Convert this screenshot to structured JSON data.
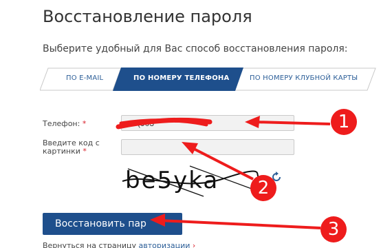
{
  "page": {
    "title": "Восстановление пароля",
    "subtitle": "Выберите удобный для Вас способ восстановления пароля:"
  },
  "tabs": [
    {
      "label": "ПО E-MAIL",
      "active": false
    },
    {
      "label": "ПО НОМЕРУ ТЕЛЕФОНА",
      "active": true
    },
    {
      "label": "ПО НОМЕРУ КЛУБНОЙ КАРТЫ",
      "active": false
    }
  ],
  "form": {
    "phone_label": "Телефон:",
    "phone_value": "+7 (903",
    "captcha_label": "Введите код с картинки",
    "captcha_value": "",
    "required_mark": "*",
    "captcha_image_text": "be5yka",
    "refresh_icon": "refresh-icon"
  },
  "actions": {
    "submit_label": "Восстановить пар"
  },
  "footer": {
    "back_text_prefix": "Вернуться на страницу ",
    "back_link": "авторизации",
    "arrow": "›"
  },
  "annotations": {
    "badges": [
      "1",
      "2",
      "3"
    ],
    "color": "#ee1c1c"
  },
  "colors": {
    "accent": "#1e4f8c",
    "link": "#2d5f98",
    "required": "#d9232d"
  }
}
